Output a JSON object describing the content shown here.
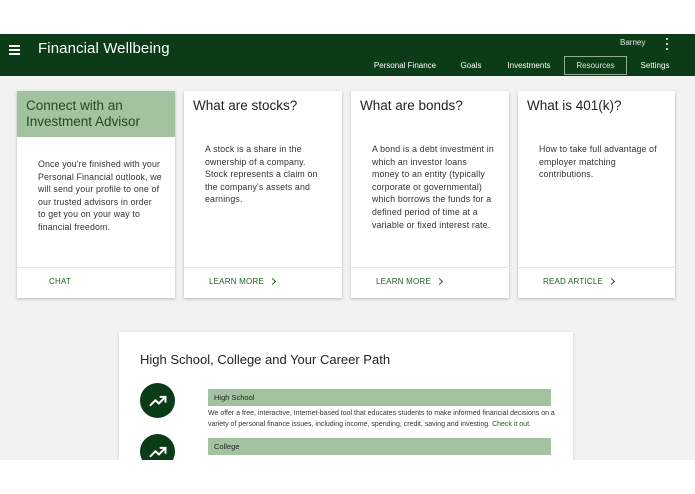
{
  "header": {
    "title": "Financial Wellbeing",
    "user_name": "Barney",
    "menu_icon": "hamburger-menu-icon",
    "more_icon": "kebab-menu-icon"
  },
  "nav": {
    "items": [
      {
        "label": "Personal Finance"
      },
      {
        "label": "Goals"
      },
      {
        "label": "Investments"
      },
      {
        "label": "Resources",
        "active": true
      },
      {
        "label": "Settings"
      }
    ]
  },
  "cards": [
    {
      "title": "Connect with an Investment Advisor",
      "body": "Once you're finished with your Personal Financial outlook, we will send your profile to one of our trusted advisors in order to get you on your way to financial freedom.",
      "action": "CHAT"
    },
    {
      "title": "What are stocks?",
      "body": "A stock is a share in the ownership of a company. Stock represents a claim on the company's assets and earnings.",
      "action": "LEARN MORE"
    },
    {
      "title": "What are bonds?",
      "body": "A bond is a debt investment in which an investor loans money to an entity (typically corporate or governmental) which borrows the funds for a defined period of time at a variable or fixed interest rate.",
      "action": "LEARN MORE"
    },
    {
      "title": "What is 401(k)?",
      "body": "How to take full advantage of employer matching contributions.",
      "action": "READ ARTICLE"
    }
  ],
  "career_section": {
    "title": "High School, College and Your Career Path",
    "items": [
      {
        "label": "High School",
        "description": "We offer a free, interactive, Internet-based tool that educates students to make informed financial decisions on a variety of personal finance issues, including income, spending, credit, saving and investing.",
        "link": "Check it out."
      },
      {
        "label": "College"
      }
    ]
  },
  "colors": {
    "brand_dark_green": "#0b3b17",
    "accent_sage": "#a3c29f",
    "link_green": "#1f5a2a",
    "background": "#f2f2f2"
  }
}
